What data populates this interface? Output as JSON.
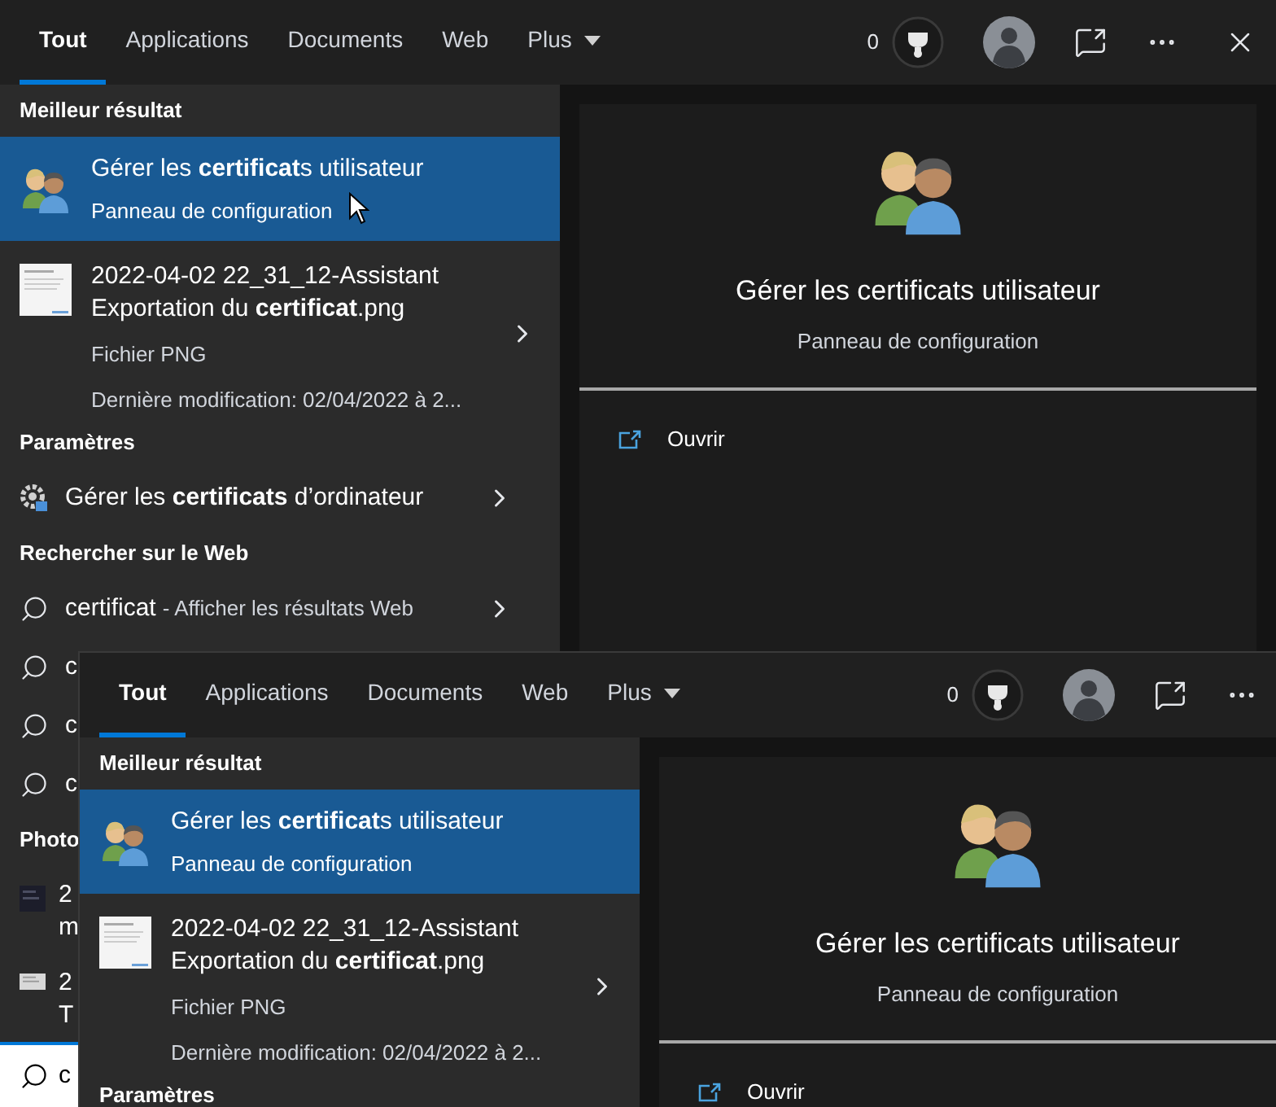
{
  "windows": [
    {
      "cursor": true,
      "tabs": [
        {
          "label": "Tout",
          "selected": true,
          "kind": "tab"
        },
        {
          "label": "Applications",
          "selected": false,
          "kind": "tab"
        },
        {
          "label": "Documents",
          "selected": false,
          "kind": "tab"
        },
        {
          "label": "Web",
          "selected": false,
          "kind": "tab"
        },
        {
          "label": "Plus",
          "selected": false,
          "kind": "menu"
        }
      ],
      "toolbar": [
        {
          "kind": "score",
          "text": "0"
        },
        {
          "kind": "avatar"
        },
        {
          "kind": "feedback"
        },
        {
          "kind": "more"
        },
        {
          "kind": "close"
        }
      ],
      "sections": [
        {
          "heading": "Meilleur résultat",
          "items": [
            {
              "kind": "best",
              "title": "Gérer les **certificat**s utilisateur",
              "subtitle": "Panneau de configuration",
              "selected": true
            },
            {
              "kind": "file",
              "title": "2022-04-02 22_31_12-Assistant Exportation du **certificat**.png",
              "subtitle": "Fichier PNG",
              "detail": "Dernière modification: 02/04/2022 à 2..."
            }
          ]
        },
        {
          "heading": "Paramètres",
          "items": [
            {
              "kind": "setting",
              "title": "Gérer les **certificats** d’ordinateur"
            }
          ]
        },
        {
          "heading": "Rechercher sur le Web",
          "items": [
            {
              "kind": "web",
              "title": "certificat",
              "hint": "- Afficher les résultats Web"
            },
            {
              "kind": "web",
              "title": "c"
            },
            {
              "kind": "web",
              "title": "c"
            },
            {
              "kind": "web",
              "title": "c"
            }
          ]
        },
        {
          "heading": "Photo",
          "items": [
            {
              "kind": "photo",
              "title": "2",
              "subtitle": "m"
            },
            {
              "kind": "photo",
              "title": "2",
              "subtitle": "T"
            }
          ]
        }
      ],
      "search": {
        "value": "c"
      },
      "preview": {
        "title": "Gérer les certificats utilisateur",
        "subtitle": "Panneau de configuration",
        "actions": [
          "Ouvrir"
        ]
      }
    },
    {
      "tabs": [
        {
          "label": "Tout",
          "selected": true,
          "kind": "tab"
        },
        {
          "label": "Applications",
          "selected": false,
          "kind": "tab"
        },
        {
          "label": "Documents",
          "selected": false,
          "kind": "tab"
        },
        {
          "label": "Web",
          "selected": false,
          "kind": "tab"
        },
        {
          "label": "Plus",
          "selected": false,
          "kind": "menu"
        }
      ],
      "toolbar": [
        {
          "kind": "score",
          "text": "0"
        },
        {
          "kind": "avatar"
        },
        {
          "kind": "feedback"
        },
        {
          "kind": "more"
        }
      ],
      "sections": [
        {
          "heading": "Meilleur résultat",
          "items": [
            {
              "kind": "best",
              "title": "Gérer les **certificat**s utilisateur",
              "subtitle": "Panneau de configuration",
              "selected": true
            },
            {
              "kind": "file",
              "title": "2022-04-02 22_31_12-Assistant Exportation du **certificat**.png",
              "subtitle": "Fichier PNG",
              "detail": "Dernière modification: 02/04/2022 à 2..."
            }
          ]
        },
        {
          "heading": "Paramètres"
        }
      ],
      "preview": {
        "title": "Gérer les certificats utilisateur",
        "subtitle": "Panneau de configuration",
        "actions": [
          "Ouvrir"
        ]
      }
    }
  ]
}
